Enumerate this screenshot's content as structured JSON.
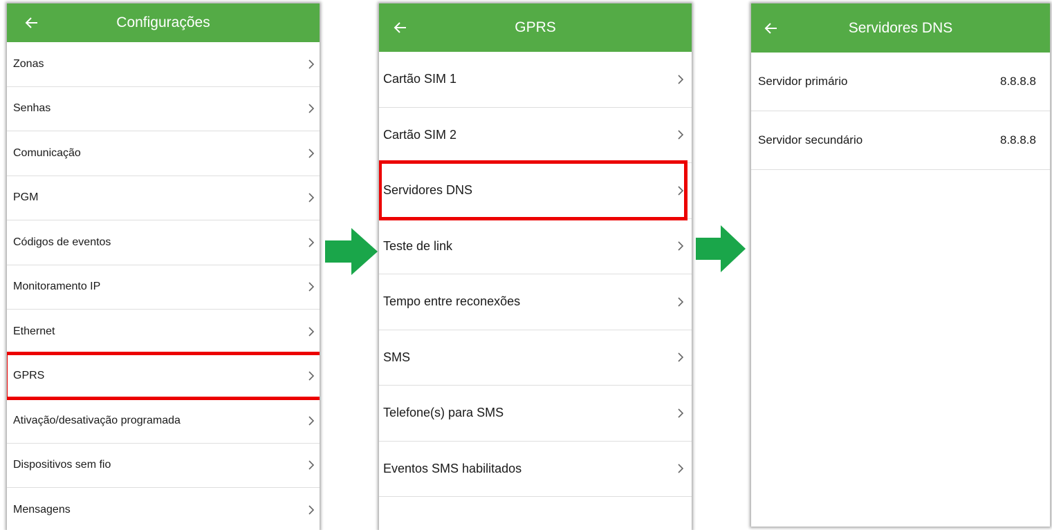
{
  "theme": {
    "header_color": "#54ab46",
    "highlight_color": "#ec0000",
    "arrow_color": "#1aa64a"
  },
  "panel1": {
    "title": "Configurações",
    "back_icon": "arrow-left-icon",
    "items": [
      {
        "label": "Zonas"
      },
      {
        "label": "Senhas"
      },
      {
        "label": "Comunicação"
      },
      {
        "label": "PGM"
      },
      {
        "label": "Códigos de eventos"
      },
      {
        "label": "Monitoramento IP"
      },
      {
        "label": "Ethernet"
      },
      {
        "label": "GPRS",
        "highlighted": true
      },
      {
        "label": "Ativação/desativação programada"
      },
      {
        "label": "Dispositivos sem fio"
      },
      {
        "label": "Mensagens"
      }
    ]
  },
  "panel2": {
    "title": "GPRS",
    "back_icon": "arrow-left-icon",
    "items": [
      {
        "label": "Cartão SIM 1"
      },
      {
        "label": "Cartão SIM 2"
      },
      {
        "label": "Servidores DNS",
        "highlighted": true
      },
      {
        "label": "Teste de link"
      },
      {
        "label": "Tempo entre reconexões"
      },
      {
        "label": "SMS"
      },
      {
        "label": "Telefone(s) para SMS"
      },
      {
        "label": "Eventos SMS habilitados"
      }
    ]
  },
  "panel3": {
    "title": "Servidores DNS",
    "back_icon": "arrow-left-icon",
    "items": [
      {
        "label": "Servidor primário",
        "value": "8.8.8.8"
      },
      {
        "label": "Servidor secundário",
        "value": "8.8.8.8"
      }
    ]
  },
  "flow_arrows": [
    "arrow-right-icon",
    "arrow-right-icon"
  ]
}
